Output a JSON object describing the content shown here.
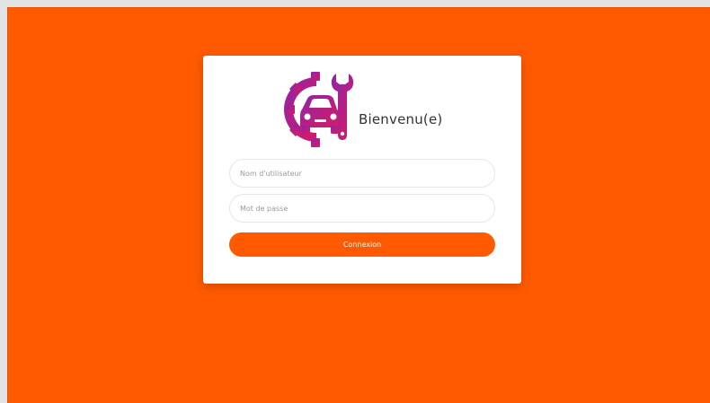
{
  "app": {
    "colors": {
      "background": "#ff5a00",
      "card": "#ffffff",
      "accent": "#ff5a00",
      "logo_primary": "#c2185b",
      "logo_secondary": "#8e24aa"
    }
  },
  "login": {
    "logo_icon": "car-gear-wrench-icon",
    "welcome_text": "Bienvenu(e)",
    "username": {
      "placeholder": "Nom d'utilisateur",
      "value": ""
    },
    "password": {
      "placeholder": "Mot de passe",
      "value": ""
    },
    "submit_label": "Connexion"
  }
}
